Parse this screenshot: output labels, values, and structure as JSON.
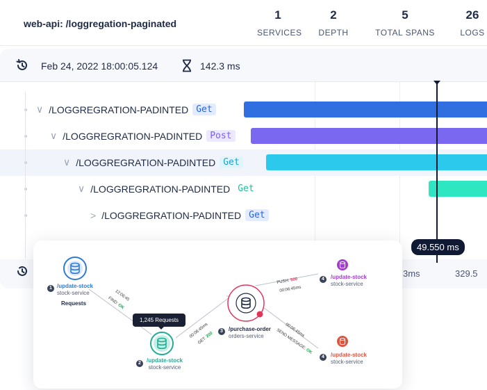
{
  "header": {
    "title": "web-api: /loggregation-paginated",
    "stats": [
      {
        "value": "1",
        "label": "SERVICES"
      },
      {
        "value": "2",
        "label": "DEPTH"
      },
      {
        "value": "5",
        "label": "TOTAL SPANS"
      },
      {
        "value": "26",
        "label": "LOGS"
      }
    ]
  },
  "meta": {
    "timestamp": "Feb 24, 2022  18:00:05.124",
    "duration": "142.3 ms",
    "clock_icon": "history-icon",
    "duration_icon": "hourglass-icon"
  },
  "spans": [
    {
      "caret": "∨",
      "name": "/LOGGREGRATION-PADINTED",
      "method": "Get",
      "method_color": "#2563eb",
      "method_bg": "#e3ecff",
      "bar_color": "#2f6fe0",
      "level": 0
    },
    {
      "caret": "∨",
      "name": "/LOGGREGRATION-PADINTED",
      "method": "Post",
      "method_color": "#7c5cff",
      "method_bg": "#ece8ff",
      "bar_color": "#7b68f0",
      "level": 1
    },
    {
      "caret": "∨",
      "name": "/LOGGREGRATION-PADINTED",
      "method": "Get",
      "method_color": "#1aa3c9",
      "method_bg": "#dff5fb",
      "bar_color": "#2cc9ec",
      "level": 2
    },
    {
      "caret": "∨",
      "name": "/LOGGREGRATION-PADINTED",
      "method": "Get",
      "method_color": "#19c29a",
      "method_bg": "#ffffff",
      "bar_color": "#2ee6c2",
      "level": 3
    },
    {
      "caret": ">",
      "name": "/LOGGREGRATION-PADINTED",
      "method": "Get",
      "method_color": "#2563eb",
      "method_bg": "#e3ecff",
      "bar_color": "",
      "level": 4
    }
  ],
  "marker_label": "49.550 ms",
  "axis": {
    "left": "3ms",
    "right": "329.5"
  },
  "map": {
    "nodes": [
      {
        "badge": "1",
        "name": "/update-stock",
        "service": "stock-service",
        "color": "#2e7bd6"
      },
      {
        "badge": "2",
        "name": "/update-stock",
        "service": "stock-service",
        "color": "#1fae95"
      },
      {
        "badge": "3",
        "name": "/purchase-order",
        "service": "orders-service",
        "color": "#e2345a"
      },
      {
        "badge": "4",
        "name": "/update-stock",
        "service": "stock-service",
        "color": "#a33cd0"
      },
      {
        "badge": "4",
        "name": "/update-stock",
        "service": "stock-service",
        "color": "#e0533f"
      }
    ],
    "requests_label": "Requests",
    "tooltip": "1,245 Requests",
    "edges": {
      "e1_time": "12:06:45",
      "e1_op": "FIND:",
      "e1_status": "OK",
      "e2_time": "00:06:45ms",
      "e2_op": "GET:",
      "e2_status": "200",
      "e3_op": "PUSH:",
      "e3_status": "500",
      "e3_time": "00:06:45ms",
      "e4_time": "00:06:45ms",
      "e4_op": "SEND MESSAGE:",
      "e4_status": "OK"
    },
    "error_badge": "!"
  }
}
